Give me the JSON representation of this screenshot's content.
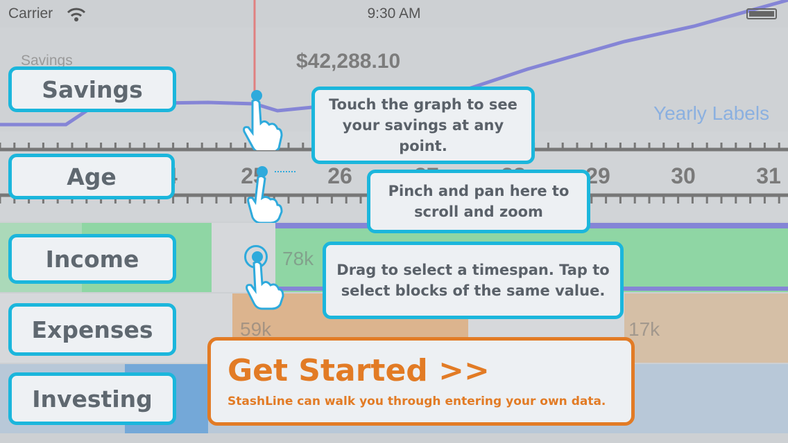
{
  "status_bar": {
    "carrier": "Carrier",
    "time": "9:30 AM",
    "wifi_icon": "wifi-icon",
    "battery_icon": "battery-icon"
  },
  "chart": {
    "background_savings_label": "Savings",
    "balance": "$42,288.10",
    "yearly_labels": "Yearly Labels",
    "ages": [
      "24",
      "25",
      "26",
      "27",
      "28",
      "29",
      "30",
      "31"
    ],
    "income_value": "78k",
    "expenses_values": [
      "59k",
      "17k"
    ]
  },
  "side_labels": {
    "savings": "Savings",
    "age": "Age",
    "income": "Income",
    "expenses": "Expenses",
    "investing": "Investing"
  },
  "tips": {
    "touch_graph": "Touch the graph to see your savings at any point.",
    "pinch_pan": "Pinch and pan here to scroll and zoom",
    "drag_select": "Drag to select a timespan. Tap to select blocks of the same value."
  },
  "get_started": {
    "title": "Get Started >>",
    "subtitle": "StashLine can walk you through entering your own data."
  },
  "colors": {
    "accent": "#1bb6dc",
    "cta": "#e27b25",
    "savings_line": "#8585d6",
    "marker": "#e08080"
  }
}
